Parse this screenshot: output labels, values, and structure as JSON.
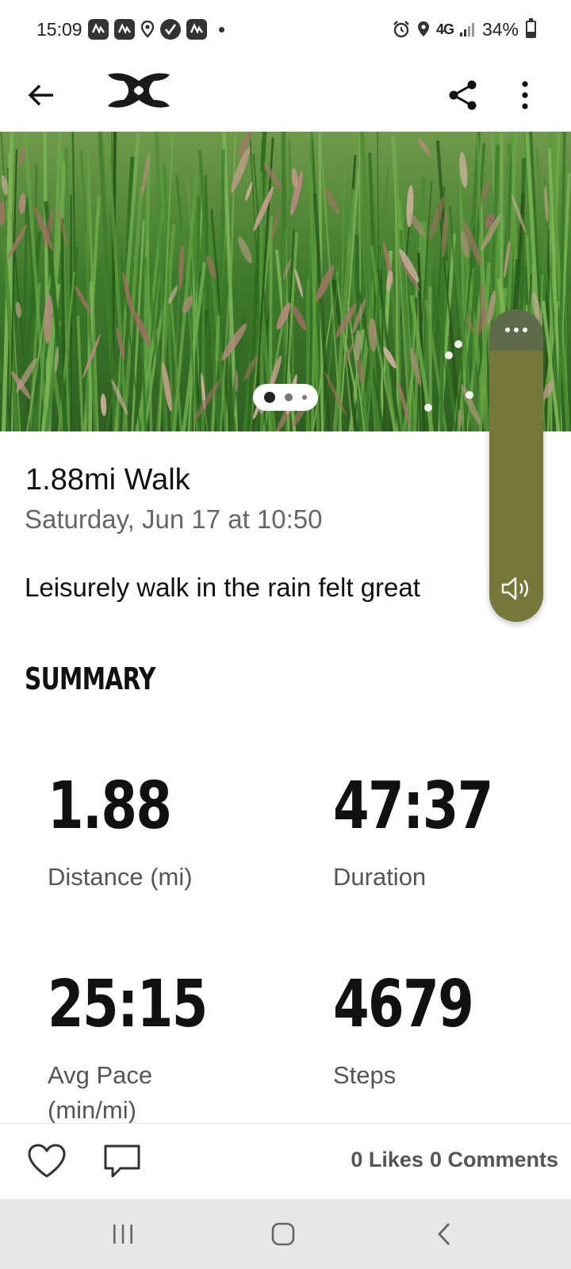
{
  "status_bar": {
    "time": "15:09",
    "network": "4G",
    "battery": "34%",
    "battery_level": 0.34
  },
  "app_bar": {
    "back_icon": "arrow-left-icon",
    "logo": "under-armour-logo",
    "share_icon": "share-icon",
    "more_icon": "more-vertical-icon"
  },
  "hero": {
    "image": "grass-meadow-photo",
    "page_count": 3,
    "current_page": 1
  },
  "workout": {
    "title": "1.88mi Walk",
    "date": "Saturday, Jun 17 at 10:50",
    "note": "Leisurely walk in the rain felt great"
  },
  "summary": {
    "heading": "SUMMARY",
    "stats": [
      {
        "value": "1.88",
        "label": "Distance (mi)"
      },
      {
        "value": "47:37",
        "label": "Duration"
      },
      {
        "value": "25:15",
        "label": "Avg Pace (min/mi)"
      },
      {
        "value": "4679",
        "label": "Steps"
      }
    ]
  },
  "social": {
    "likes": "0 Likes",
    "comments": "0 Comments",
    "like_icon": "heart-icon",
    "comment_icon": "comment-icon"
  },
  "colors": {
    "panel": "#76783a",
    "panel_top": "#5e6a4a",
    "grass": "#3f7a2a"
  }
}
